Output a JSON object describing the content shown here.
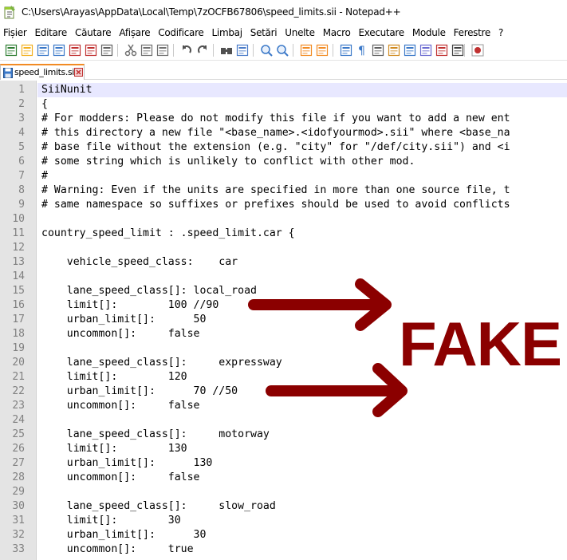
{
  "window": {
    "title": "C:\\Users\\Arayas\\AppData\\Local\\Temp\\7zOCFB67806\\speed_limits.sii - Notepad++"
  },
  "menu": [
    "Fișier",
    "Editare",
    "Căutare",
    "Afișare",
    "Codificare",
    "Limbaj",
    "Setări",
    "Unelte",
    "Macro",
    "Executare",
    "Module",
    "Ferestre",
    "?"
  ],
  "toolbar": {
    "icons": [
      "new-file-icon",
      "open-file-icon",
      "save-icon",
      "save-all-icon",
      "close-icon",
      "close-all-icon",
      "print-icon",
      "cut-icon",
      "copy-icon",
      "paste-icon",
      "undo-icon",
      "redo-icon",
      "find-icon",
      "replace-icon",
      "zoom-in-icon",
      "zoom-out-icon",
      "sync-vertical-icon",
      "sync-horizontal-icon",
      "word-wrap-icon",
      "show-all-chars-icon",
      "indent-guide-icon",
      "udl-icon",
      "doc-map-icon",
      "function-list-icon",
      "folder-workspace-icon",
      "monitoring-icon",
      "record-macro-icon"
    ]
  },
  "tab": {
    "label": "speed_limits.sii"
  },
  "editor": {
    "lines": [
      "SiiNunit",
      "{",
      "# For modders: Please do not modify this file if you want to add a new ent",
      "# this directory a new file \"<base_name>.<idofyourmod>.sii\" where <base_na",
      "# base file without the extension (e.g. \"city\" for \"/def/city.sii\") and <i",
      "# some string which is unlikely to conflict with other mod.",
      "#",
      "# Warning: Even if the units are specified in more than one source file, t",
      "# same namespace so suffixes or prefixes should be used to avoid conflicts",
      "",
      "country_speed_limit : .speed_limit.car {",
      "",
      "    vehicle_speed_class:    car",
      "",
      "    lane_speed_class[]: local_road",
      "    limit[]:        100 //90",
      "    urban_limit[]:      50",
      "    uncommon[]:     false",
      "",
      "    lane_speed_class[]:     expressway",
      "    limit[]:        120",
      "    urban_limit[]:      70 //50",
      "    uncommon[]:     false",
      "",
      "    lane_speed_class[]:     motorway",
      "    limit[]:        130",
      "    urban_limit[]:      130",
      "    uncommon[]:     false",
      "",
      "    lane_speed_class[]:     slow_road",
      "    limit[]:        30",
      "    urban_limit[]:      30",
      "    uncommon[]:     true"
    ]
  },
  "annotation": {
    "text": "FAKE",
    "color": "#8b0000"
  },
  "colors": {
    "current_line": "#e8e8ff",
    "gutter": "#e4e4e4",
    "tab_accent": "#f28b24"
  }
}
